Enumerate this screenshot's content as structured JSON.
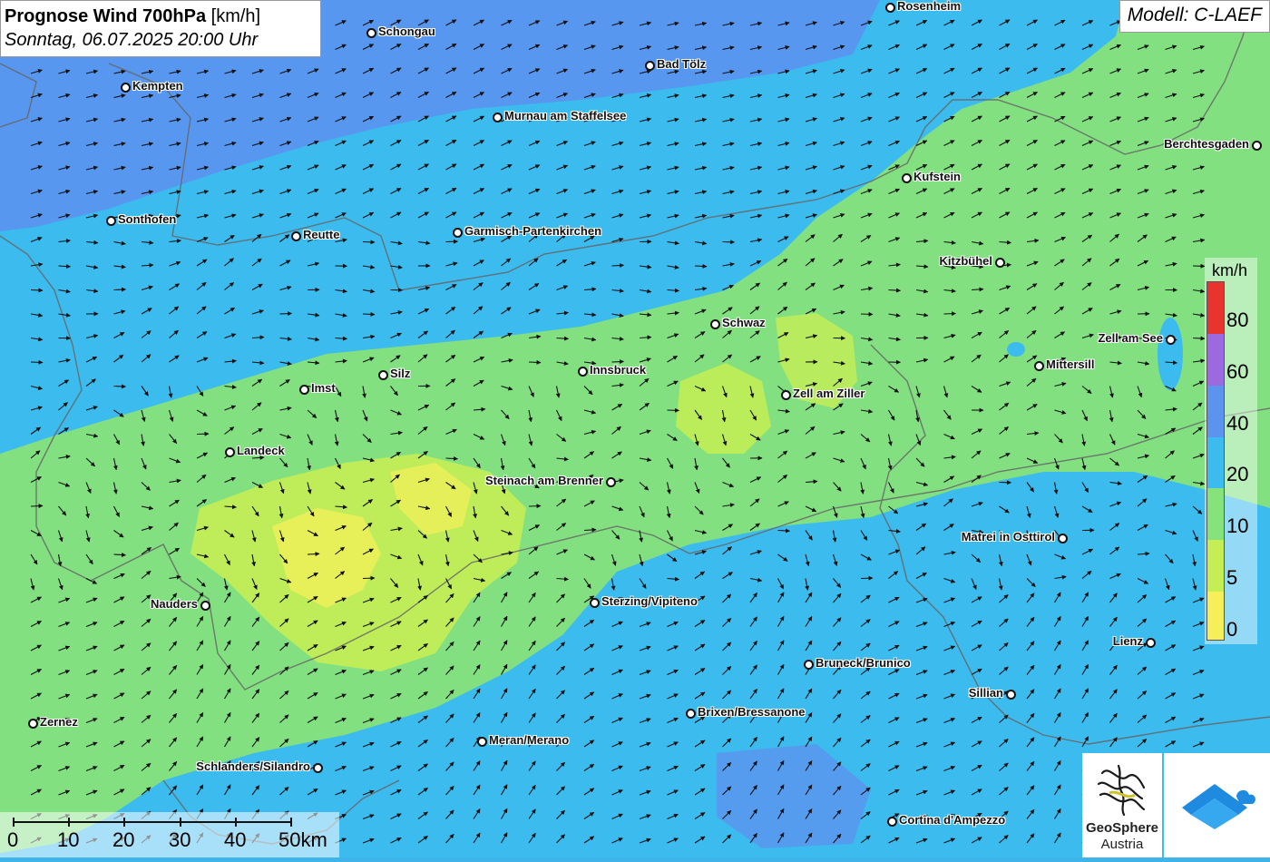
{
  "title": {
    "main": "Prognose Wind 700hPa",
    "unit": "[km/h]",
    "subtitle": "Sonntag, 06.07.2025 20:00 Uhr"
  },
  "model": "Modell: C-LAEF",
  "legend": {
    "unit": "km/h",
    "labels": [
      "80",
      "60",
      "40",
      "20",
      "10",
      "5",
      "0"
    ],
    "colors": [
      "#e8342e",
      "#9b6ae0",
      "#5b93ee",
      "#3cbbef",
      "#86e27a",
      "#c5ee55",
      "#f5f05a"
    ]
  },
  "scale_bar": {
    "labels": [
      "0",
      "10",
      "20",
      "30",
      "40",
      "50km"
    ]
  },
  "logo": {
    "line1": "GeoSphere",
    "line2": "Austria"
  },
  "cities": [
    "Rosenheim",
    "Schongau",
    "Bad Tölz",
    "Kempten",
    "Murnau am Staffelsee",
    "Berchtesgaden",
    "Kufstein",
    "Sonthofen",
    "Reutte",
    "Garmisch-Partenkirchen",
    "Kitzbühel",
    "Schwaz",
    "Zell am See",
    "Mittersill",
    "Silz",
    "Innsbruck",
    "Imst",
    "Zell am Ziller",
    "Landeck",
    "Steinach am Brenner",
    "Matrei in Osttirol",
    "Nauders",
    "Sterzing/Vipiteno",
    "Lienz",
    "Bruneck/Brunico",
    "Sillian",
    "Brixen/Bressanone",
    "Zernez",
    "Meran/Merano",
    "Schlanders/Silandro",
    "Cortina d'Ampezzo"
  ],
  "colors": {
    "calm": "#f5f05a",
    "light": "#c5ee55",
    "moderate": "#86e27a",
    "fresh": "#3cbbef",
    "strong": "#5b93ee"
  }
}
